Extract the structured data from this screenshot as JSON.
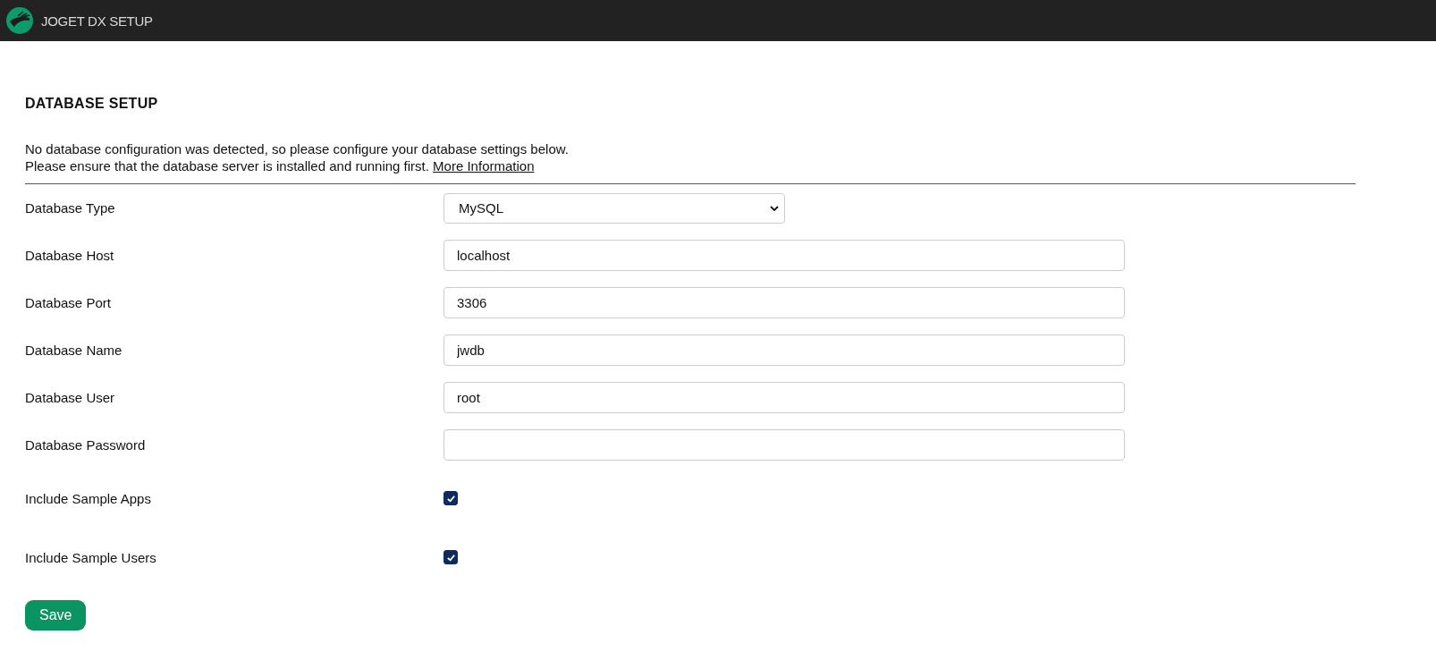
{
  "header": {
    "title": "JOGET DX SETUP"
  },
  "section": {
    "title": "DATABASE SETUP",
    "intro_line1": "No database configuration was detected, so please configure your database settings below.",
    "intro_line2": "Please ensure that the database server is installed and running first.",
    "link": "More Information"
  },
  "fields": [
    {
      "kind": "select",
      "label": "Database Type",
      "value": "MySQL"
    },
    {
      "kind": "text",
      "label": "Database Host",
      "value": "localhost"
    },
    {
      "kind": "text",
      "label": "Database Port",
      "value": "3306"
    },
    {
      "kind": "text",
      "label": "Database Name",
      "value": "jwdb"
    },
    {
      "kind": "text",
      "label": "Database User",
      "value": "root"
    },
    {
      "kind": "password",
      "label": "Database Password"
    },
    {
      "kind": "checkbox",
      "label": "Include Sample Apps",
      "checked": true
    },
    {
      "kind": "checkbox",
      "label": "Include Sample Users",
      "checked": true
    }
  ],
  "save_button": "Save"
}
